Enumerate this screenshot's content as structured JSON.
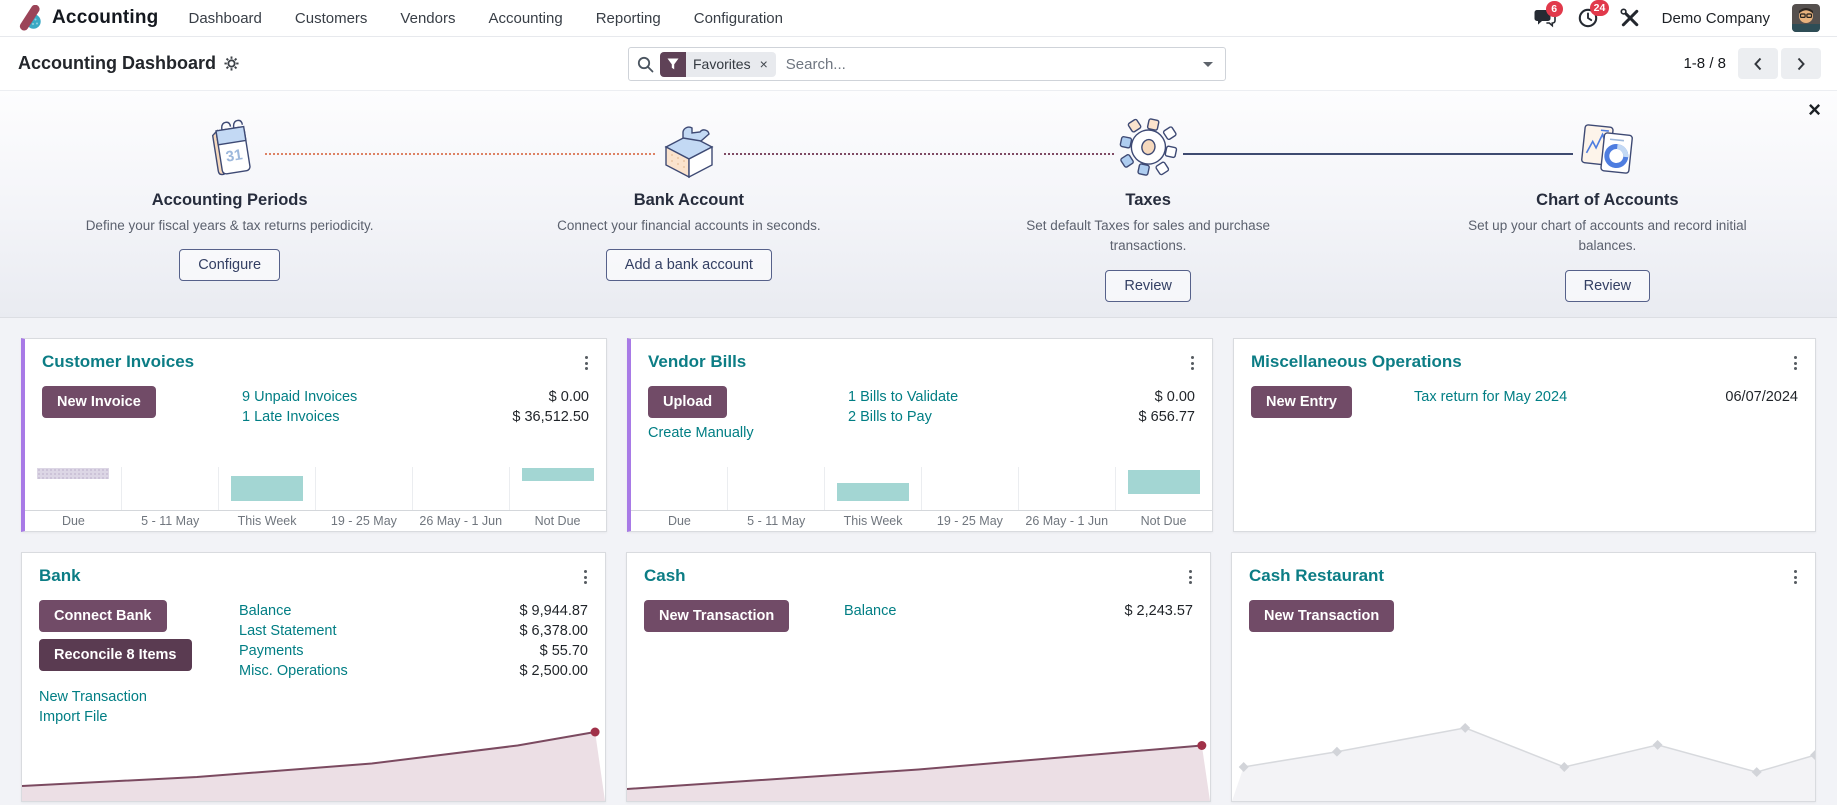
{
  "navbar": {
    "brand": "Accounting",
    "menu": [
      "Dashboard",
      "Customers",
      "Vendors",
      "Accounting",
      "Reporting",
      "Configuration"
    ],
    "messages_badge": "6",
    "activities_badge": "24",
    "company": "Demo Company"
  },
  "control_panel": {
    "title": "Accounting Dashboard",
    "search": {
      "placeholder": "Search...",
      "filter_label": "Favorites"
    },
    "pager": {
      "display": "1-8 / 8"
    }
  },
  "ui": {
    "close_glyph": "×"
  },
  "onboarding": {
    "steps": [
      {
        "icon": "calendar-icon",
        "title": "Accounting Periods",
        "description": "Define your fiscal years & tax returns periodicity.",
        "button": "Configure"
      },
      {
        "icon": "puzzle-icon",
        "title": "Bank Account",
        "description": "Connect your financial accounts in seconds.",
        "button": "Add a bank account"
      },
      {
        "icon": "gear-illustration-icon",
        "title": "Taxes",
        "description": "Set default Taxes for sales and purchase transactions.",
        "button": "Review"
      },
      {
        "icon": "chart-docs-icon",
        "title": "Chart of Accounts",
        "description": "Set up your chart of accounts and record initial balances.",
        "button": "Review"
      }
    ]
  },
  "cards": {
    "customer_invoices": {
      "title": "Customer Invoices",
      "button": "New Invoice",
      "rows": [
        {
          "label": "9 Unpaid Invoices",
          "amount": "$ 0.00"
        },
        {
          "label": "1 Late Invoices",
          "amount": "$ 36,512.50"
        }
      ]
    },
    "vendor_bills": {
      "title": "Vendor Bills",
      "button": "Upload",
      "secondary_link": "Create Manually",
      "rows": [
        {
          "label": "1 Bills to Validate",
          "amount": "$ 0.00"
        },
        {
          "label": "2 Bills to Pay",
          "amount": "$ 656.77"
        }
      ]
    },
    "misc_operations": {
      "title": "Miscellaneous Operations",
      "button": "New Entry",
      "rows": [
        {
          "label": "Tax return for May 2024",
          "amount": "06/07/2024"
        }
      ]
    },
    "bank": {
      "title": "Bank",
      "buttons": [
        "Connect Bank",
        "Reconcile 8 Items"
      ],
      "links": [
        "New Transaction",
        "Import File"
      ],
      "rows": [
        {
          "label": "Balance",
          "amount": "$ 9,944.87"
        },
        {
          "label": "Last Statement",
          "amount": "$ 6,378.00"
        },
        {
          "label": "Payments",
          "amount": "$ 55.70"
        },
        {
          "label": "Misc. Operations",
          "amount": "$ 2,500.00"
        }
      ]
    },
    "cash": {
      "title": "Cash",
      "button": "New Transaction",
      "rows": [
        {
          "label": "Balance",
          "amount": "$ 2,243.57"
        }
      ]
    },
    "cash_restaurant": {
      "title": "Cash Restaurant",
      "button": "New Transaction"
    }
  },
  "theme": {
    "primary": "#714b67",
    "primary_dark": "#5a3b51",
    "teal": "#017e84",
    "purple_border": "#a87ae6",
    "badge_red": "#e1394b",
    "bar_teal": "#a3d6d3",
    "line_maroon": "#7b4a60",
    "line_fill": "#ecdfe5"
  },
  "chart_data": [
    {
      "id": "customer-invoices-graph",
      "type": "bar",
      "title": "Customer invoices due amounts by period",
      "categories": [
        "Due",
        "5 - 11 May",
        "This Week",
        "19 - 25 May",
        "26 May - 1 Jun",
        "Not Due"
      ],
      "note": "No numeric axis shown; bar sizes are relative fractions of plot height, offset = distance from plot top",
      "bars": [
        {
          "value": 0.24,
          "offset": 0.03,
          "color": "striped"
        },
        {
          "value": 0
        },
        {
          "value": 0.6,
          "offset": 0.2,
          "color": "teal"
        },
        {
          "value": 0
        },
        {
          "value": 0
        },
        {
          "value": 0.3,
          "offset": 0.03,
          "color": "teal"
        }
      ]
    },
    {
      "id": "vendor-bills-graph",
      "type": "bar",
      "title": "Vendor bills due amounts by period",
      "categories": [
        "Due",
        "5 - 11 May",
        "This Week",
        "19 - 25 May",
        "26 May - 1 Jun",
        "Not Due"
      ],
      "note": "No numeric axis shown; bar sizes are relative fractions of plot height, offset = distance from plot top",
      "bars": [
        {
          "value": 0
        },
        {
          "value": 0
        },
        {
          "value": 0.4,
          "offset": 0.38,
          "color": "teal"
        },
        {
          "value": 0
        },
        {
          "value": 0
        },
        {
          "value": 0.55,
          "offset": 0.07,
          "color": "teal"
        }
      ]
    },
    {
      "id": "bank-graph",
      "type": "area",
      "title": "Bank balance trend (rising, no axis labels)",
      "points": [
        [
          0,
          80
        ],
        [
          30,
          68
        ],
        [
          60,
          50
        ],
        [
          85,
          26
        ],
        [
          98.3,
          8
        ]
      ],
      "color": "#7b4a60",
      "fill": "#ecdfe5",
      "stroke_width": 2,
      "end_dot": true,
      "end_dot_color": "#a03048"
    },
    {
      "id": "cash-graph",
      "type": "area",
      "title": "Cash balance trend (rising, no axis labels)",
      "points": [
        [
          0,
          84
        ],
        [
          50,
          58
        ],
        [
          98.6,
          26
        ]
      ],
      "color": "#7b4a60",
      "fill": "#ecdfe5",
      "stroke_width": 2,
      "end_dot": true,
      "end_dot_color": "#a03048"
    },
    {
      "id": "cash-restaurant-graph",
      "type": "area",
      "title": "Cash Restaurant sample trend (placeholder zigzag, no data)",
      "points": [
        [
          2,
          60
        ],
        [
          18,
          42
        ],
        [
          40,
          14
        ],
        [
          57,
          60
        ],
        [
          73,
          34
        ],
        [
          90,
          66
        ],
        [
          100,
          46
        ]
      ],
      "color": "#d7d9dd",
      "fill": "#f3f3f6",
      "stroke_width": 1.5,
      "markers": "diamond",
      "marker_color": "#d2d4d9"
    }
  ]
}
